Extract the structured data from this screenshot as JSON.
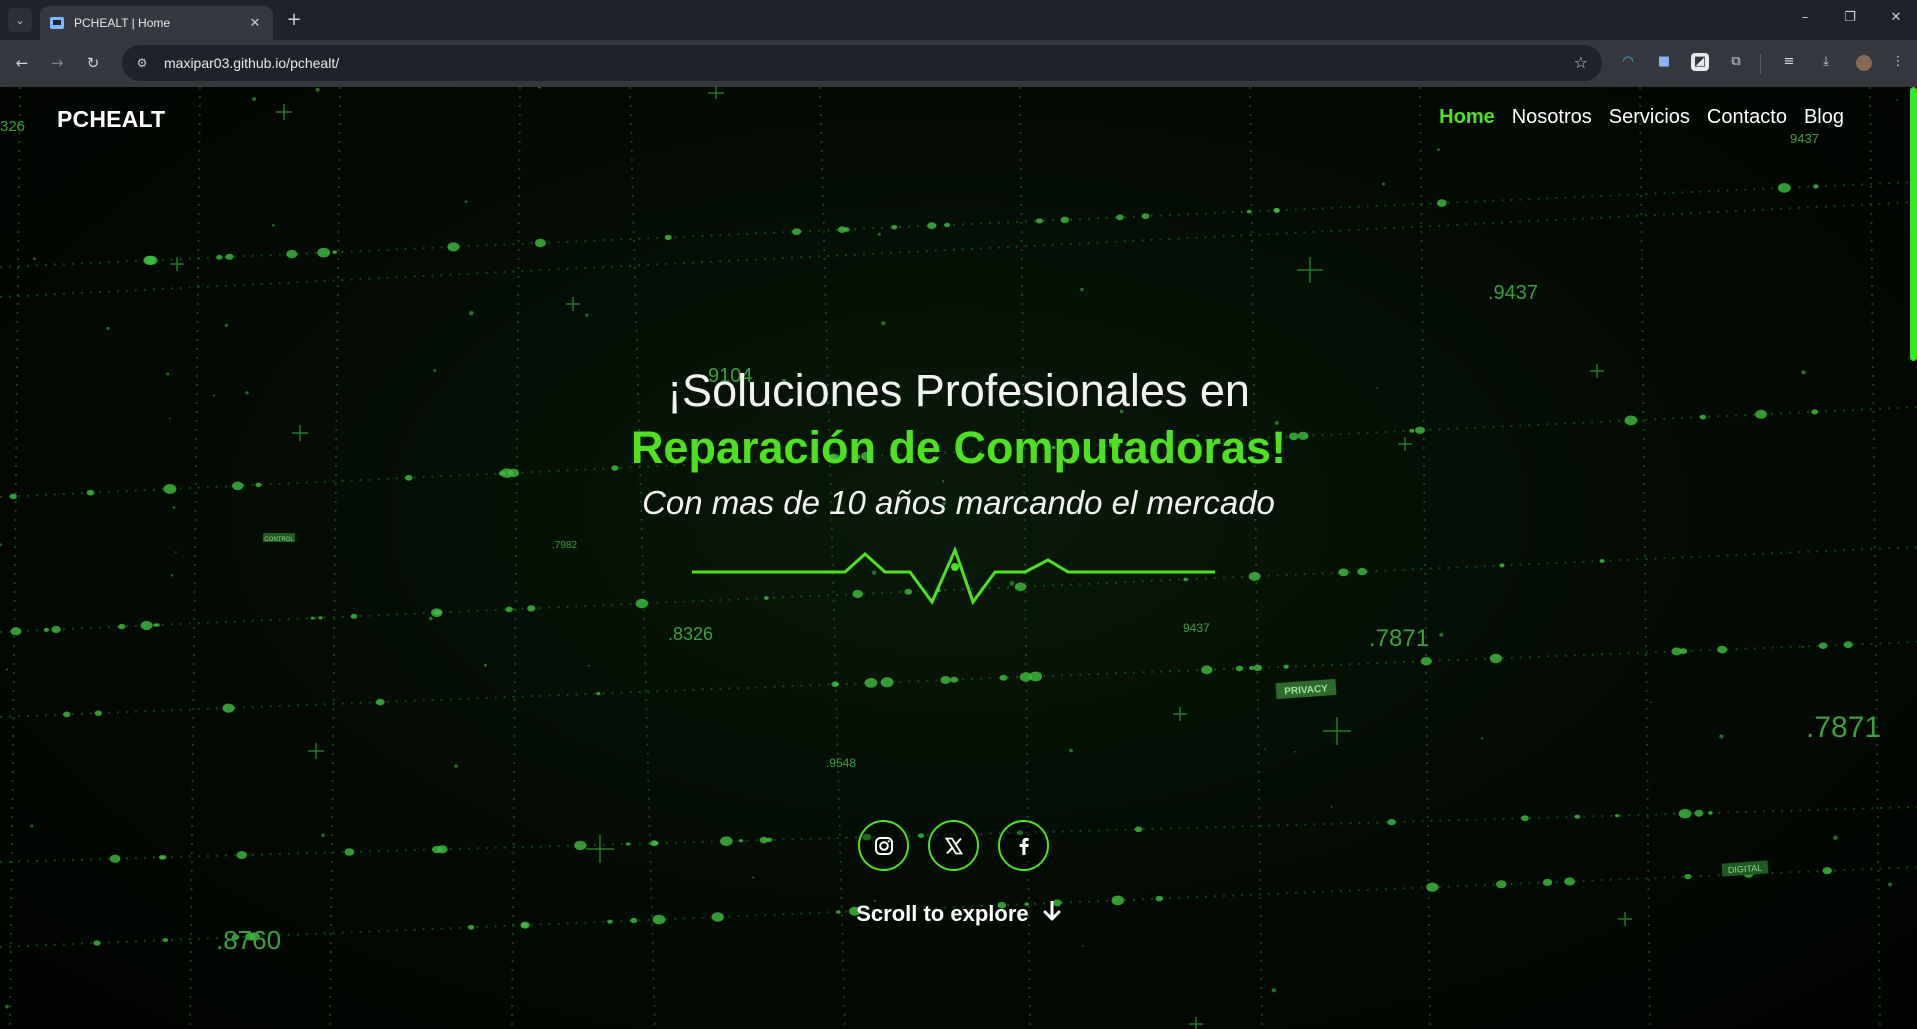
{
  "browser": {
    "tab_title": "PCHEALT | Home",
    "tab_close": "✕",
    "new_tab": "+",
    "url": "maxipar03.github.io/pchealt/",
    "icons": [
      "tab-search-icon",
      "favicon-icon",
      "back-icon",
      "forward-icon",
      "reload-icon",
      "site-info-icon",
      "bookmark-star-icon",
      "extension-icon",
      "downloads-icon",
      "profile-avatar-icon",
      "menu-icon"
    ],
    "window_controls": {
      "minimize": "–",
      "restore": "❐",
      "close": "✕"
    }
  },
  "site": {
    "brand": "PCHEALT",
    "nav": [
      {
        "label": "Home",
        "active": true
      },
      {
        "label": "Nosotros",
        "active": false
      },
      {
        "label": "Servicios",
        "active": false
      },
      {
        "label": "Contacto",
        "active": false
      },
      {
        "label": "Blog",
        "active": false
      }
    ],
    "hero": {
      "line1": "¡Soluciones Profesionales en",
      "line2": "Reparación de Computadoras!",
      "subtitle": "Con mas de 10 años marcando el mercado"
    },
    "social": [
      {
        "name": "instagram",
        "icon": "instagram-icon"
      },
      {
        "name": "x",
        "icon": "x-icon"
      },
      {
        "name": "facebook",
        "icon": "facebook-icon"
      }
    ],
    "scroll_label": "Scroll to explore",
    "background_labels": {
      "n326": "326",
      "n9437a": "9437",
      "n9437b": ".9437",
      "n9104": "9104",
      "n7982": ".7982",
      "n8326": ".8326",
      "n9437c": "9437",
      "n7871a": ".7871",
      "n7871b": ".7871",
      "n9548": ".9548",
      "n8760": ".8760",
      "privacy": "PRIVACY",
      "control": "CONTROL",
      "digital": "DIGITAL"
    },
    "colors": {
      "accent": "#4de11f",
      "background": "#010301",
      "text": "#ffffff"
    }
  }
}
